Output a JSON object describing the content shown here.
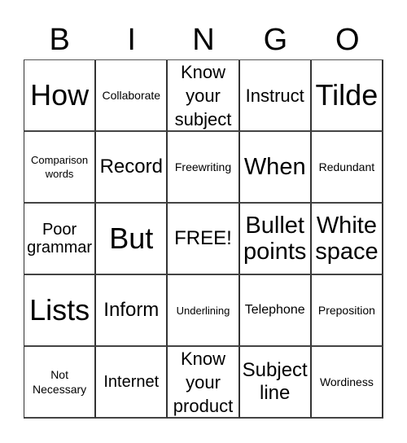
{
  "header": {
    "letters": [
      "B",
      "I",
      "N",
      "G",
      "O"
    ]
  },
  "card": {
    "rows": [
      [
        "How",
        "Collaborate",
        "Know\nyour\nsubject",
        "Instruct",
        "Tilde"
      ],
      [
        "Comparison\nwords",
        "Record",
        "Freewriting",
        "When",
        "Redundant"
      ],
      [
        "Poor\ngrammar",
        "But",
        "FREE!",
        "Bullet\npoints",
        "White\nspace"
      ],
      [
        "Lists",
        "Inform",
        "Underlining",
        "Telephone",
        "Preposition"
      ],
      [
        "Not\nNecessary",
        "Internet",
        "Know\nyour\nproduct",
        "Subject\nline",
        "Wordiness"
      ]
    ],
    "free_space_label": "FREE!"
  }
}
